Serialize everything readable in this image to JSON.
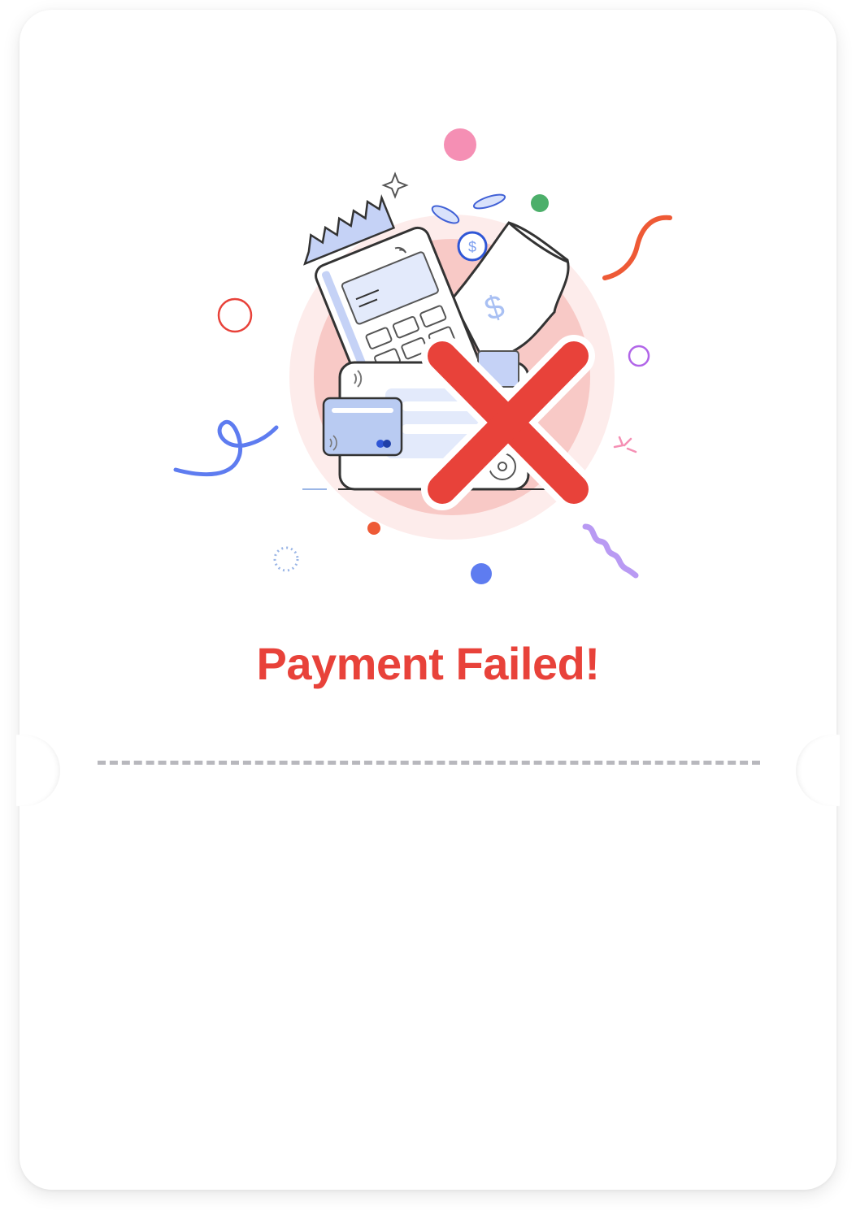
{
  "status": {
    "title": "Payment Failed!"
  },
  "illustration": {
    "icon": "payment-failed-icon",
    "error_mark": "close-icon"
  },
  "colors": {
    "error": "#E8423A",
    "accent_blue": "#5E7CF0",
    "soft_red": "#F8C9C6",
    "divider": "#B8B8BD"
  }
}
